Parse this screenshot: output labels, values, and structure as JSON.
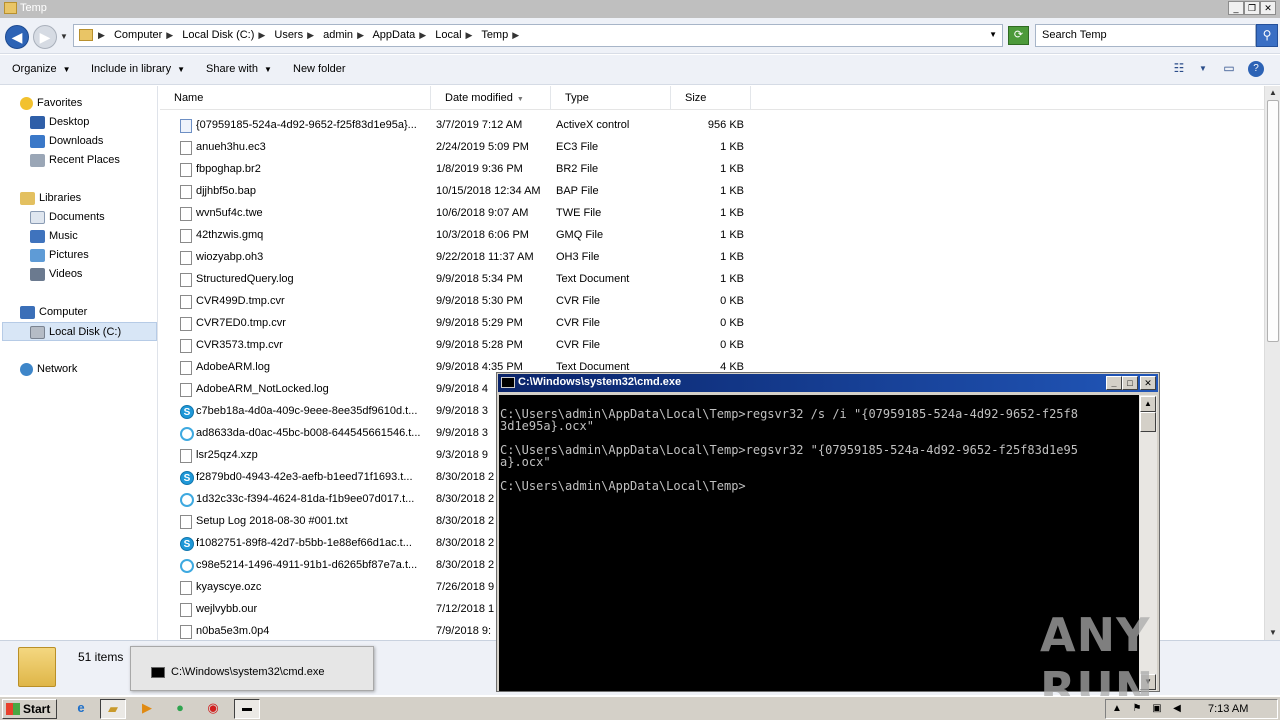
{
  "window": {
    "title": "Temp"
  },
  "address": {
    "crumbs": [
      "Computer",
      "Local Disk (C:)",
      "Users",
      "admin",
      "AppData",
      "Local",
      "Temp"
    ],
    "search_placeholder": "Search Temp"
  },
  "toolbar": {
    "organize": "Organize",
    "include": "Include in library",
    "share": "Share with",
    "new_folder": "New folder"
  },
  "nav": {
    "favorites": "Favorites",
    "desktop": "Desktop",
    "downloads": "Downloads",
    "recent": "Recent Places",
    "libraries": "Libraries",
    "documents": "Documents",
    "music": "Music",
    "pictures": "Pictures",
    "videos": "Videos",
    "computer": "Computer",
    "localdisk": "Local Disk (C:)",
    "network": "Network"
  },
  "columns": {
    "name": "Name",
    "date": "Date modified",
    "type": "Type",
    "size": "Size"
  },
  "files": [
    {
      "name": "{07959185-524a-4d92-9652-f25f83d1e95a}...",
      "date": "3/7/2019 7:12 AM",
      "type": "ActiveX control",
      "size": "956 KB",
      "icon": "activex-icon"
    },
    {
      "name": "anueh3hu.ec3",
      "date": "2/24/2019 5:09 PM",
      "type": "EC3 File",
      "size": "1 KB",
      "icon": "file-icon"
    },
    {
      "name": "fbpoghap.br2",
      "date": "1/8/2019 9:36 PM",
      "type": "BR2 File",
      "size": "1 KB",
      "icon": "file-icon"
    },
    {
      "name": "djjhbf5o.bap",
      "date": "10/15/2018 12:34 AM",
      "type": "BAP File",
      "size": "1 KB",
      "icon": "file-icon"
    },
    {
      "name": "wvn5uf4c.twe",
      "date": "10/6/2018 9:07 AM",
      "type": "TWE File",
      "size": "1 KB",
      "icon": "file-icon"
    },
    {
      "name": "42thzwis.gmq",
      "date": "10/3/2018 6:06 PM",
      "type": "GMQ File",
      "size": "1 KB",
      "icon": "file-icon"
    },
    {
      "name": "wiozyabp.oh3",
      "date": "9/22/2018 11:37 AM",
      "type": "OH3 File",
      "size": "1 KB",
      "icon": "file-icon"
    },
    {
      "name": "StructuredQuery.log",
      "date": "9/9/2018 5:34 PM",
      "type": "Text Document",
      "size": "1 KB",
      "icon": "text-file-icon"
    },
    {
      "name": "CVR499D.tmp.cvr",
      "date": "9/9/2018 5:30 PM",
      "type": "CVR File",
      "size": "0 KB",
      "icon": "file-icon"
    },
    {
      "name": "CVR7ED0.tmp.cvr",
      "date": "9/9/2018 5:29 PM",
      "type": "CVR File",
      "size": "0 KB",
      "icon": "file-icon"
    },
    {
      "name": "CVR3573.tmp.cvr",
      "date": "9/9/2018 5:28 PM",
      "type": "CVR File",
      "size": "0 KB",
      "icon": "file-icon"
    },
    {
      "name": "AdobeARM.log",
      "date": "9/9/2018 4:35 PM",
      "type": "Text Document",
      "size": "4 KB",
      "icon": "text-file-icon"
    },
    {
      "name": "AdobeARM_NotLocked.log",
      "date": "9/9/2018 4",
      "type": "",
      "size": "",
      "icon": "text-file-icon"
    },
    {
      "name": "c7beb18a-4d0a-409c-9eee-8ee35df9610d.t...",
      "date": "9/9/2018 3",
      "type": "",
      "size": "",
      "icon": "skype-icon"
    },
    {
      "name": "ad8633da-d0ac-45bc-b008-644545661546.t...",
      "date": "9/9/2018 3",
      "type": "",
      "size": "",
      "icon": "edge-icon"
    },
    {
      "name": "lsr25qz4.xzp",
      "date": "9/3/2018 9",
      "type": "",
      "size": "",
      "icon": "file-icon"
    },
    {
      "name": "f2879bd0-4943-42e3-aefb-b1eed71f1693.t...",
      "date": "8/30/2018 2",
      "type": "",
      "size": "",
      "icon": "skype-icon"
    },
    {
      "name": "1d32c33c-f394-4624-81da-f1b9ee07d017.t...",
      "date": "8/30/2018 2",
      "type": "",
      "size": "",
      "icon": "edge-icon"
    },
    {
      "name": "Setup Log 2018-08-30 #001.txt",
      "date": "8/30/2018 2",
      "type": "",
      "size": "",
      "icon": "text-file-icon"
    },
    {
      "name": "f1082751-89f8-42d7-b5bb-1e88ef66d1ac.t...",
      "date": "8/30/2018 2",
      "type": "",
      "size": "",
      "icon": "skype-icon"
    },
    {
      "name": "c98e5214-1496-4911-91b1-d6265bf87e7a.t...",
      "date": "8/30/2018 2",
      "type": "",
      "size": "",
      "icon": "edge-icon"
    },
    {
      "name": "kyayscye.ozc",
      "date": "7/26/2018 9",
      "type": "",
      "size": "",
      "icon": "file-icon"
    },
    {
      "name": "wejlvybb.our",
      "date": "7/12/2018 1",
      "type": "",
      "size": "",
      "icon": "file-icon"
    },
    {
      "name": "n0ba5e3m.0p4",
      "date": "7/9/2018 9:",
      "type": "",
      "size": "",
      "icon": "file-icon"
    }
  ],
  "status": {
    "item_count": "51 items"
  },
  "thumbnail": {
    "label": "C:\\Windows\\system32\\cmd.exe"
  },
  "cmd": {
    "title": "C:\\Windows\\system32\\cmd.exe",
    "lines": [
      "C:\\Users\\admin\\AppData\\Local\\Temp>regsvr32 /s /i \"{07959185-524a-4d92-9652-f25f8",
      "3d1e95a}.ocx\"",
      "",
      "C:\\Users\\admin\\AppData\\Local\\Temp>regsvr32 \"{07959185-524a-4d92-9652-f25f83d1e95",
      "a}.ocx\"",
      "",
      "C:\\Users\\admin\\AppData\\Local\\Temp>"
    ]
  },
  "watermark": "ANY RUN",
  "taskbar": {
    "start": "Start",
    "clock": "7:13 AM"
  }
}
